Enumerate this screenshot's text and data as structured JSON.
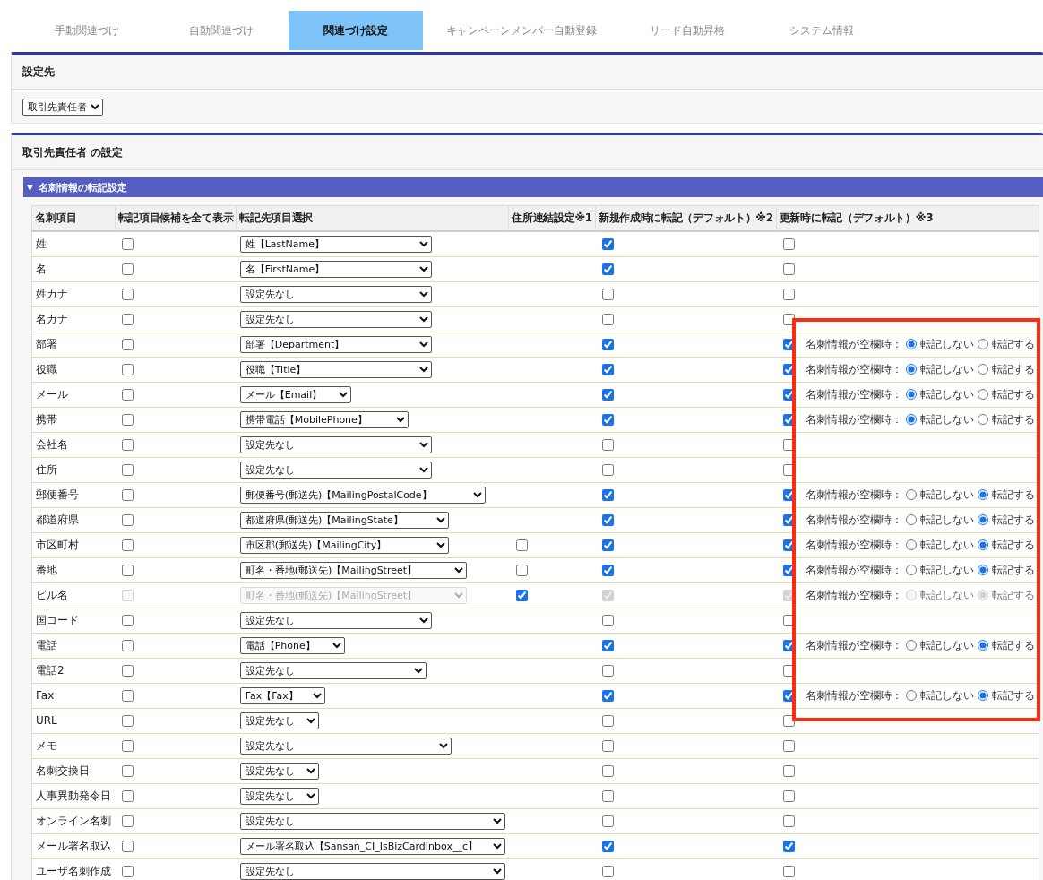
{
  "tabs": [
    {
      "label": "手動関連づけ",
      "selected": false
    },
    {
      "label": "自動関連づけ",
      "selected": false
    },
    {
      "label": "関連づけ設定",
      "selected": true
    },
    {
      "label": "キャンペーンメンバー自動登録",
      "selected": false
    },
    {
      "label": "リード自動昇格",
      "selected": false
    },
    {
      "label": "システム情報",
      "selected": false
    }
  ],
  "target_panel": {
    "title": "設定先",
    "select": "取引先責任者"
  },
  "settings_panel": {
    "title": "取引先責任者 の設定",
    "section": {
      "toggle": "▼",
      "title": "名刺情報の転記設定"
    },
    "columns": [
      "名刺項目",
      "転記項目候補を全て表示",
      "転記先項目選択",
      "住所連結設定※1",
      "新規作成時に転記（デフォルト）※2",
      "更新時に転記（デフォルト）※3"
    ],
    "rows": [
      {
        "label": "姓",
        "show_all": {
          "checked": false,
          "disabled": false
        },
        "target": {
          "value": "姓【LastName】",
          "disabled": false
        },
        "new_default": {
          "checked": true,
          "disabled": false
        },
        "update_default": {
          "checked": false,
          "disabled": false
        }
      },
      {
        "label": "名",
        "show_all": {
          "checked": false,
          "disabled": false
        },
        "target": {
          "value": "名【FirstName】",
          "disabled": false
        },
        "new_default": {
          "checked": true,
          "disabled": false
        },
        "update_default": {
          "checked": false,
          "disabled": false
        }
      },
      {
        "label": "姓カナ",
        "show_all": {
          "checked": false,
          "disabled": false
        },
        "target": {
          "value": "設定先なし",
          "disabled": false
        },
        "new_default": {
          "checked": false,
          "disabled": false
        },
        "update_default": {
          "checked": false,
          "disabled": false
        }
      },
      {
        "label": "名カナ",
        "show_all": {
          "checked": false,
          "disabled": false
        },
        "target": {
          "value": "設定先なし",
          "disabled": false
        },
        "new_default": {
          "checked": false,
          "disabled": false
        },
        "update_default": {
          "checked": false,
          "disabled": false
        }
      },
      {
        "label": "部署",
        "show_all": {
          "checked": false,
          "disabled": false
        },
        "target": {
          "value": "部署【Department】",
          "disabled": false
        },
        "new_default": {
          "checked": true,
          "disabled": false
        },
        "update_default": {
          "checked": true,
          "disabled": false
        },
        "blank_option": {
          "label": "名刺情報が空欄時：",
          "disabled": false,
          "options": [
            {
              "label": "転記しない",
              "selected": true
            },
            {
              "label": "転記する",
              "selected": false
            }
          ]
        }
      },
      {
        "label": "役職",
        "show_all": {
          "checked": false,
          "disabled": false
        },
        "target": {
          "value": "役職【Title】",
          "disabled": false
        },
        "new_default": {
          "checked": true,
          "disabled": false
        },
        "update_default": {
          "checked": true,
          "disabled": false
        },
        "blank_option": {
          "label": "名刺情報が空欄時：",
          "disabled": false,
          "options": [
            {
              "label": "転記しない",
              "selected": true
            },
            {
              "label": "転記する",
              "selected": false
            }
          ]
        }
      },
      {
        "label": "メール",
        "show_all": {
          "checked": false,
          "disabled": false
        },
        "target": {
          "value": "メール【Email】",
          "disabled": false
        },
        "new_default": {
          "checked": true,
          "disabled": false
        },
        "update_default": {
          "checked": true,
          "disabled": false
        },
        "blank_option": {
          "label": "名刺情報が空欄時：",
          "disabled": false,
          "options": [
            {
              "label": "転記しない",
              "selected": true
            },
            {
              "label": "転記する",
              "selected": false
            }
          ]
        }
      },
      {
        "label": "携帯",
        "show_all": {
          "checked": false,
          "disabled": false
        },
        "target": {
          "value": "携帯電話【MobilePhone】",
          "disabled": false
        },
        "new_default": {
          "checked": true,
          "disabled": false
        },
        "update_default": {
          "checked": true,
          "disabled": false
        },
        "blank_option": {
          "label": "名刺情報が空欄時：",
          "disabled": false,
          "options": [
            {
              "label": "転記しない",
              "selected": true
            },
            {
              "label": "転記する",
              "selected": false
            }
          ]
        }
      },
      {
        "label": "会社名",
        "show_all": {
          "checked": false,
          "disabled": false
        },
        "target": {
          "value": "設定先なし",
          "disabled": false
        },
        "new_default": {
          "checked": false,
          "disabled": false
        },
        "update_default": {
          "checked": false,
          "disabled": false
        }
      },
      {
        "label": "住所",
        "show_all": {
          "checked": false,
          "disabled": false
        },
        "target": {
          "value": "設定先なし",
          "disabled": false
        },
        "new_default": {
          "checked": false,
          "disabled": false
        },
        "update_default": {
          "checked": false,
          "disabled": false
        }
      },
      {
        "label": "郵便番号",
        "show_all": {
          "checked": false,
          "disabled": false
        },
        "target": {
          "value": "郵便番号(郵送先)【MailingPostalCode】",
          "disabled": false
        },
        "new_default": {
          "checked": true,
          "disabled": false
        },
        "update_default": {
          "checked": true,
          "disabled": false
        },
        "blank_option": {
          "label": "名刺情報が空欄時：",
          "disabled": false,
          "options": [
            {
              "label": "転記しない",
              "selected": false
            },
            {
              "label": "転記する",
              "selected": true
            }
          ]
        }
      },
      {
        "label": "都道府県",
        "show_all": {
          "checked": false,
          "disabled": false
        },
        "target": {
          "value": "都道府県(郵送先)【MailingState】",
          "disabled": false
        },
        "new_default": {
          "checked": true,
          "disabled": false
        },
        "update_default": {
          "checked": true,
          "disabled": false
        },
        "blank_option": {
          "label": "名刺情報が空欄時：",
          "disabled": false,
          "options": [
            {
              "label": "転記しない",
              "selected": false
            },
            {
              "label": "転記する",
              "selected": true
            }
          ]
        }
      },
      {
        "label": "市区町村",
        "show_all": {
          "checked": false,
          "disabled": false
        },
        "target": {
          "value": "市区郡(郵送先)【MailingCity】",
          "disabled": false
        },
        "address_link": {
          "checked": false,
          "disabled": false
        },
        "new_default": {
          "checked": true,
          "disabled": false
        },
        "update_default": {
          "checked": true,
          "disabled": false
        },
        "blank_option": {
          "label": "名刺情報が空欄時：",
          "disabled": false,
          "options": [
            {
              "label": "転記しない",
              "selected": false
            },
            {
              "label": "転記する",
              "selected": true
            }
          ]
        }
      },
      {
        "label": "番地",
        "show_all": {
          "checked": false,
          "disabled": false
        },
        "target": {
          "value": "町名・番地(郵送先)【MailingStreet】",
          "disabled": false
        },
        "address_link": {
          "checked": false,
          "disabled": false
        },
        "new_default": {
          "checked": true,
          "disabled": false
        },
        "update_default": {
          "checked": true,
          "disabled": false
        },
        "blank_option": {
          "label": "名刺情報が空欄時：",
          "disabled": false,
          "options": [
            {
              "label": "転記しない",
              "selected": false
            },
            {
              "label": "転記する",
              "selected": true
            }
          ]
        }
      },
      {
        "label": "ビル名",
        "show_all": {
          "checked": false,
          "disabled": true
        },
        "target": {
          "value": "町名・番地(郵送先)【MailingStreet】",
          "disabled": true
        },
        "address_link": {
          "checked": true,
          "disabled": false
        },
        "new_default": {
          "checked": true,
          "disabled": true
        },
        "update_default": {
          "checked": true,
          "disabled": true
        },
        "blank_option": {
          "label": "名刺情報が空欄時：",
          "disabled": true,
          "options": [
            {
              "label": "転記しない",
              "selected": false
            },
            {
              "label": "転記する",
              "selected": true
            }
          ]
        }
      },
      {
        "label": "国コード",
        "show_all": {
          "checked": false,
          "disabled": false
        },
        "target": {
          "value": "設定先なし",
          "disabled": false
        },
        "new_default": {
          "checked": false,
          "disabled": false
        },
        "update_default": {
          "checked": false,
          "disabled": false
        }
      },
      {
        "label": "電話",
        "show_all": {
          "checked": false,
          "disabled": false
        },
        "target": {
          "value": "電話【Phone】",
          "disabled": false
        },
        "new_default": {
          "checked": true,
          "disabled": false
        },
        "update_default": {
          "checked": true,
          "disabled": false
        },
        "blank_option": {
          "label": "名刺情報が空欄時：",
          "disabled": false,
          "options": [
            {
              "label": "転記しない",
              "selected": false
            },
            {
              "label": "転記する",
              "selected": true
            }
          ]
        }
      },
      {
        "label": "電話2",
        "show_all": {
          "checked": false,
          "disabled": false
        },
        "target": {
          "value": "設定先なし",
          "disabled": false
        },
        "new_default": {
          "checked": false,
          "disabled": false
        },
        "update_default": {
          "checked": false,
          "disabled": false
        }
      },
      {
        "label": "Fax",
        "show_all": {
          "checked": false,
          "disabled": false
        },
        "target": {
          "value": "Fax【Fax】",
          "disabled": false
        },
        "new_default": {
          "checked": true,
          "disabled": false
        },
        "update_default": {
          "checked": true,
          "disabled": false
        },
        "blank_option": {
          "label": "名刺情報が空欄時：",
          "disabled": false,
          "options": [
            {
              "label": "転記しない",
              "selected": false
            },
            {
              "label": "転記する",
              "selected": true
            }
          ]
        }
      },
      {
        "label": "URL",
        "show_all": {
          "checked": false,
          "disabled": false
        },
        "target": {
          "value": "設定先なし",
          "disabled": false
        },
        "new_default": {
          "checked": false,
          "disabled": false
        },
        "update_default": {
          "checked": false,
          "disabled": false
        }
      },
      {
        "label": "メモ",
        "show_all": {
          "checked": false,
          "disabled": false
        },
        "target": {
          "value": "設定先なし",
          "disabled": false
        },
        "new_default": {
          "checked": false,
          "disabled": false
        },
        "update_default": {
          "checked": false,
          "disabled": false
        }
      },
      {
        "label": "名刺交換日",
        "show_all": {
          "checked": false,
          "disabled": false
        },
        "target": {
          "value": "設定先なし",
          "disabled": false
        },
        "new_default": {
          "checked": false,
          "disabled": false
        },
        "update_default": {
          "checked": false,
          "disabled": false
        }
      },
      {
        "label": "人事異動発令日",
        "show_all": {
          "checked": false,
          "disabled": false
        },
        "target": {
          "value": "設定先なし",
          "disabled": false
        },
        "new_default": {
          "checked": false,
          "disabled": false
        },
        "update_default": {
          "checked": false,
          "disabled": false
        }
      },
      {
        "label": "オンライン名刺",
        "show_all": {
          "checked": false,
          "disabled": false
        },
        "target": {
          "value": "設定先なし",
          "disabled": false
        },
        "new_default": {
          "checked": false,
          "disabled": false
        },
        "update_default": {
          "checked": false,
          "disabled": false
        }
      },
      {
        "label": "メール署名取込",
        "show_all": {
          "checked": false,
          "disabled": false
        },
        "target": {
          "value": "メール署名取込【Sansan_CI_IsBizCardInbox__c】",
          "disabled": false
        },
        "new_default": {
          "checked": true,
          "disabled": false
        },
        "update_default": {
          "checked": true,
          "disabled": false
        }
      },
      {
        "label": "ユーザ名刺作成",
        "show_all": {
          "checked": false,
          "disabled": false
        },
        "target": {
          "value": "設定先なし",
          "disabled": false
        },
        "new_default": {
          "checked": false,
          "disabled": false
        },
        "update_default": {
          "checked": false,
          "disabled": false
        }
      }
    ]
  }
}
